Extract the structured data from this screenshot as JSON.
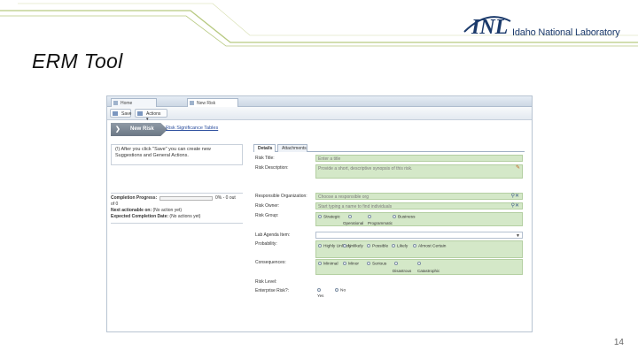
{
  "slide": {
    "title": "ERM Tool",
    "page_number": "14",
    "logo": {
      "mark": "INL",
      "name": "Idaho National Laboratory"
    },
    "colors": {
      "deco_line": "#b7c980",
      "logo": "#1b3a6b",
      "field_green": "#d4e8c8"
    }
  },
  "app": {
    "tabs": [
      {
        "label": "Home",
        "icon": "home-tab-icon"
      },
      {
        "label": "New Risk",
        "icon": "document-tab-icon"
      }
    ],
    "toolbar": {
      "save_label": "Save",
      "actions_label": "Actions",
      "save_icon": "save-icon",
      "actions_icon": "actions-icon",
      "dropdown_icon": "chevron-down-icon"
    },
    "wizard": {
      "step_label": "New Risk",
      "step_icon": "chevron-right-icon",
      "link_label": "Risk Significance Tables"
    },
    "info_box": {
      "badge": "(!)",
      "text": "After you click \"Save\" you can create new Suggestions and General Actions."
    },
    "progress": {
      "completion_label": "Completion Progress:",
      "completion_fraction": 0,
      "completion_text": "0% - 0 out",
      "completion_text_cont": "of 0",
      "next_action_label": "Next actionable on:",
      "next_action_value": "(No action yet)",
      "expected_label": "Expected Completion Date:",
      "expected_value": "(No actions yet)"
    },
    "form": {
      "tabs": [
        {
          "label": "Details"
        },
        {
          "label": "Attachments"
        }
      ],
      "fields": {
        "risk_title": {
          "label": "Risk Title:",
          "placeholder": "Enter a title"
        },
        "risk_description": {
          "label": "Risk Description:",
          "placeholder": "Provide a short, descriptive synopsis of this risk."
        },
        "responsible_org": {
          "label": "Responsible Organization:",
          "placeholder": "Choose a responsible org"
        },
        "risk_owner": {
          "label": "Risk Owner:",
          "placeholder": "Start typing a name to find individuals"
        },
        "risk_group": {
          "label": "Risk Group:",
          "options": [
            "Strategic",
            "Operational",
            "Programmatic",
            "Business"
          ]
        },
        "lab_agenda": {
          "label": "Lab Agenda Item:",
          "value": ""
        },
        "probability": {
          "label": "Probability:",
          "options": [
            "Highly Unlikely",
            "Unlikely",
            "Possible",
            "Likely",
            "Almost Certain"
          ]
        },
        "consequences": {
          "label": "Consequences:",
          "options": [
            "Minimal",
            "Minor",
            "Serious",
            "Disastrous",
            "Catastrophic"
          ]
        },
        "risk_level": {
          "label": "Risk Level:"
        },
        "enterprise_risk": {
          "label": "Enterprise Risk?:",
          "options": [
            "Yes",
            "No"
          ]
        }
      },
      "icons": {
        "edit": "pencil-icon",
        "search": "search-icon",
        "clear": "clear-icon",
        "dropdown": "chevron-down-icon"
      }
    }
  }
}
